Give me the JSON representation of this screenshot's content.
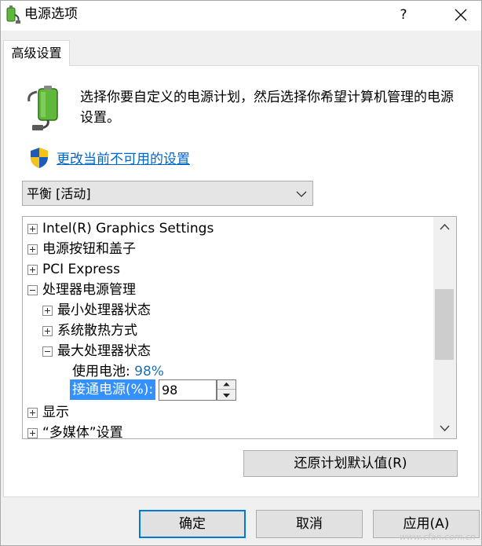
{
  "window": {
    "title": "电源选项",
    "help_label": "?"
  },
  "tab": {
    "label": "高级设置"
  },
  "intro": {
    "text": "选择你要自定义的电源计划，然后选择你希望计算机管理的电源设置。"
  },
  "change_link": {
    "label": "更改当前不可用的设置"
  },
  "plan_select": {
    "value": "平衡 [活动]"
  },
  "tree": {
    "items": [
      {
        "label": "Intel(R) Graphics Settings",
        "state": "collapsed"
      },
      {
        "label": "电源按钮和盖子",
        "state": "collapsed"
      },
      {
        "label": "PCI Express",
        "state": "collapsed"
      },
      {
        "label": "处理器电源管理",
        "state": "expanded"
      },
      {
        "label": "最小处理器状态",
        "state": "collapsed"
      },
      {
        "label": "系统散热方式",
        "state": "collapsed"
      },
      {
        "label": "最大处理器状态",
        "state": "expanded"
      },
      {
        "label": "显示",
        "state": "collapsed"
      },
      {
        "label": "“多媒体”设置",
        "state": "collapsed"
      }
    ],
    "battery": {
      "label": "使用电池:",
      "value": "98%"
    },
    "plugged_in": {
      "label": "接通电源(%):",
      "value": "98"
    }
  },
  "buttons": {
    "restore": "还原计划默认值(R)",
    "ok": "确定",
    "cancel": "取消",
    "apply": "应用(A)"
  },
  "watermark": "www.cfan.com.cn",
  "colors": {
    "link": "#0066cc",
    "selection": "#3390ff",
    "value_blue": "#1f6fb2",
    "default_button_border": "#0078d7"
  }
}
